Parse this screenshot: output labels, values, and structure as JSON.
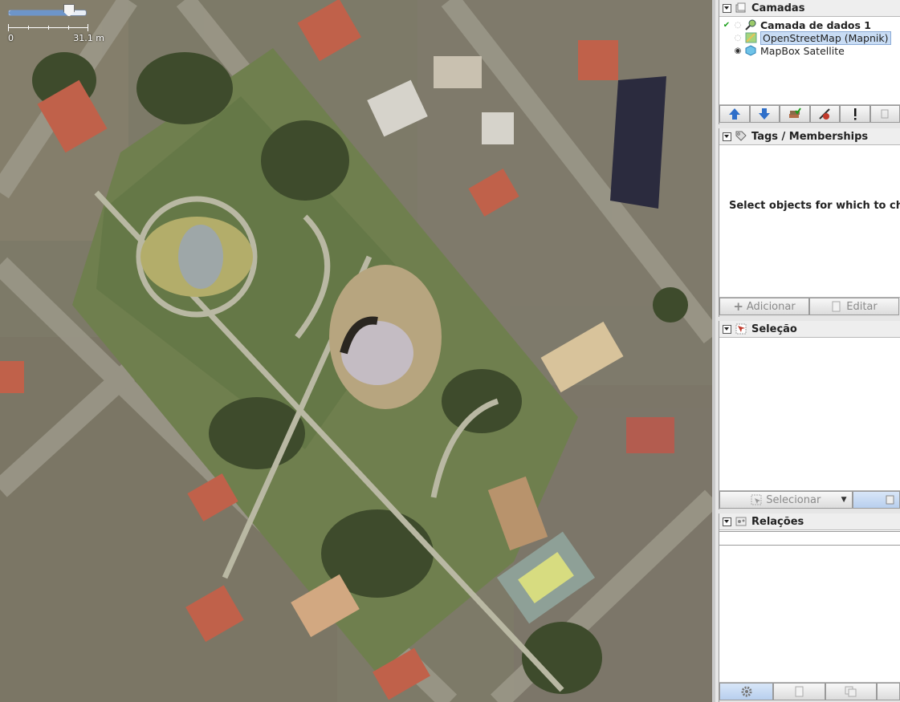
{
  "map": {
    "scale": {
      "left_label": "0",
      "right_label": "31.1 m"
    },
    "zoom_level": 0.78
  },
  "layers_dialog": {
    "title": "Camadas",
    "layers": [
      {
        "name": "Camada de dados 1",
        "active": true,
        "visible": true
      },
      {
        "name": "OpenStreetMap (Mapnik)",
        "selected": true,
        "visible": false
      },
      {
        "name": "MapBox Satellite",
        "visible": true
      }
    ]
  },
  "tags_dialog": {
    "title": "Tags / Memberships",
    "empty_message": "Select objects for which to change tags.",
    "add_label": "Adicionar",
    "edit_label": "Editar"
  },
  "selection_dialog": {
    "title": "Seleção",
    "select_label": "Selecionar"
  },
  "relations_dialog": {
    "title": "Relações"
  },
  "colors": {
    "grass": "#6f7f4e",
    "path": "#b9b8a3",
    "roof_red": "#c0614a",
    "panel_bg": "#e6e6e6",
    "accent_blue": "#2f6fc9"
  }
}
